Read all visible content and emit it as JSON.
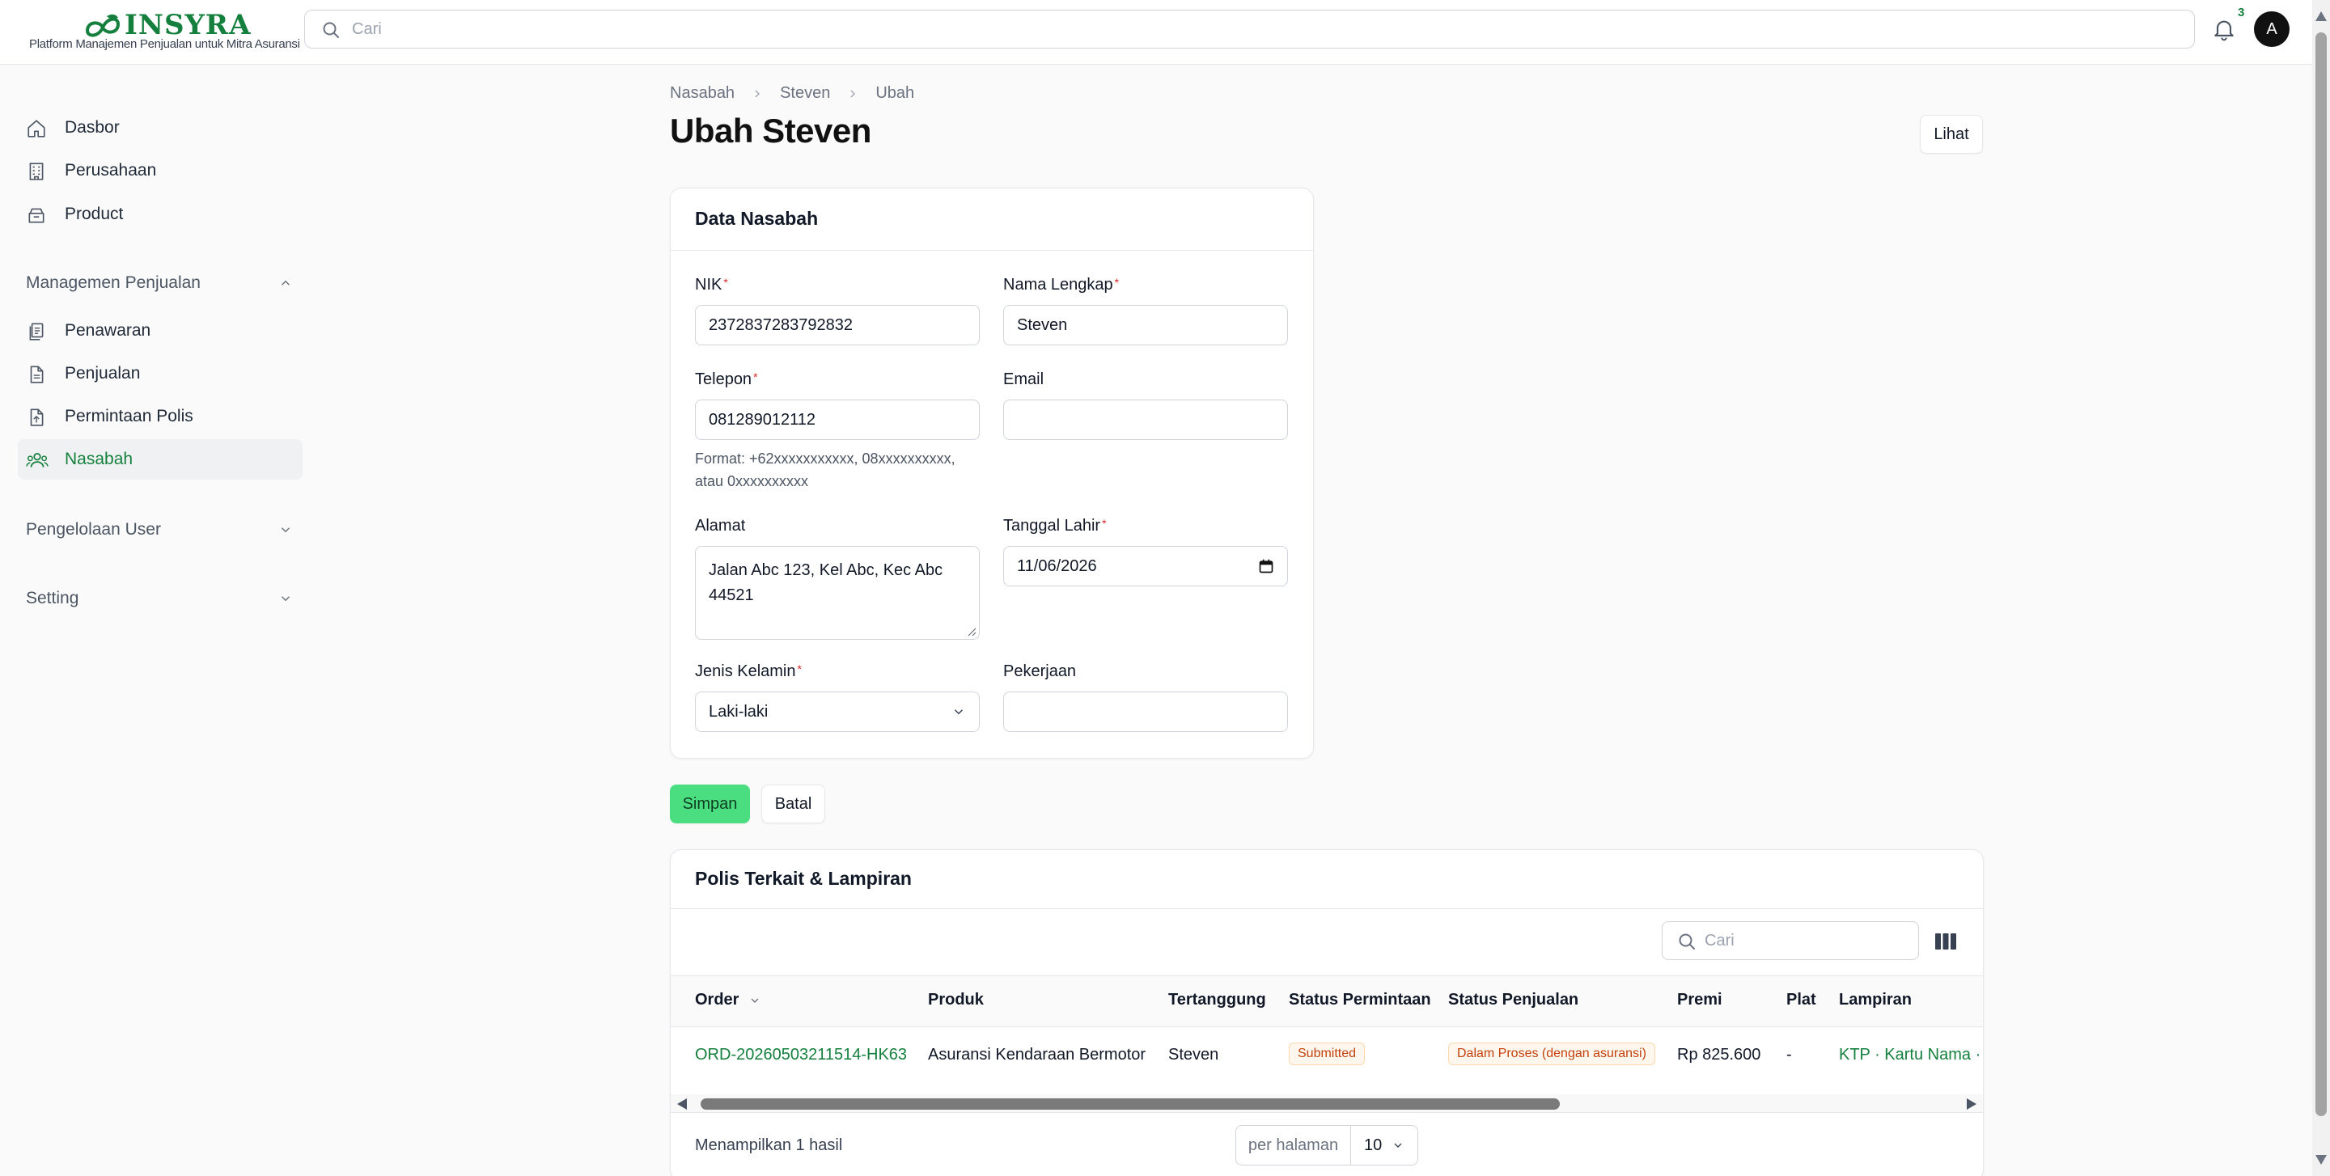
{
  "header": {
    "logo_text": "INSYRA",
    "tagline": "Platform Manajemen Penjualan untuk Mitra Asuransi",
    "search_placeholder": "Cari",
    "notification_count": "3",
    "avatar_initial": "A"
  },
  "sidebar": {
    "top_items": [
      {
        "label": "Dasbor",
        "icon": "home-icon"
      },
      {
        "label": "Perusahaan",
        "icon": "building-icon"
      },
      {
        "label": "Product",
        "icon": "box-icon"
      }
    ],
    "groups": [
      {
        "label": "Managemen Penjualan",
        "expanded": true,
        "items": [
          {
            "label": "Penawaran",
            "icon": "documents-icon"
          },
          {
            "label": "Penjualan",
            "icon": "file-icon"
          },
          {
            "label": "Permintaan Polis",
            "icon": "file-upload-icon"
          },
          {
            "label": "Nasabah",
            "icon": "users-icon",
            "active": true
          }
        ]
      },
      {
        "label": "Pengelolaan User",
        "expanded": false
      },
      {
        "label": "Setting",
        "expanded": false
      }
    ]
  },
  "breadcrumb": [
    "Nasabah",
    "Steven",
    "Ubah"
  ],
  "page": {
    "title": "Ubah Steven",
    "view_button": "Lihat"
  },
  "form": {
    "title": "Data Nasabah",
    "nik": {
      "label": "NIK",
      "value": "2372837283792832",
      "required": true
    },
    "nama": {
      "label": "Nama Lengkap",
      "value": "Steven",
      "required": true
    },
    "telepon": {
      "label": "Telepon",
      "value": "081289012112",
      "required": true,
      "hint": "Format: +62xxxxxxxxxxx, 08xxxxxxxxxx, atau 0xxxxxxxxxx"
    },
    "email": {
      "label": "Email",
      "value": ""
    },
    "alamat": {
      "label": "Alamat",
      "value": "Jalan Abc 123, Kel Abc, Kec Abc 44521"
    },
    "tanggal_lahir": {
      "label": "Tanggal Lahir",
      "value": "11/06/2026",
      "required": true
    },
    "jenis_kelamin": {
      "label": "Jenis Kelamin",
      "value": "Laki-laki",
      "required": true
    },
    "pekerjaan": {
      "label": "Pekerjaan",
      "value": ""
    },
    "save_label": "Simpan",
    "cancel_label": "Batal"
  },
  "related": {
    "title": "Polis Terkait & Lampiran",
    "search_placeholder": "Cari",
    "columns": [
      "Order",
      "Produk",
      "Tertanggung",
      "Status Permintaan",
      "Status Penjualan",
      "Premi",
      "Plat",
      "Lampiran"
    ],
    "rows": [
      {
        "order": "ORD-20260503211514-HK63",
        "produk": "Asuransi Kendaraan Bermotor",
        "tertanggung": "Steven",
        "status_permintaan": "Submitted",
        "status_penjualan": "Dalam Proses (dengan asuransi)",
        "premi": "Rp 825.600",
        "plat": "-",
        "lampiran": "KTP · Kartu Nama · B"
      }
    ],
    "result_text": "Menampilkan 1 hasil",
    "per_page_label": "per halaman",
    "per_page_value": "10"
  },
  "colors": {
    "brand": "#15803d",
    "primary_button": "#4ade80",
    "required": "#dc2626",
    "badge_submitted_bg": "#fff7ed",
    "badge_submitted_fg": "#c2410c"
  }
}
